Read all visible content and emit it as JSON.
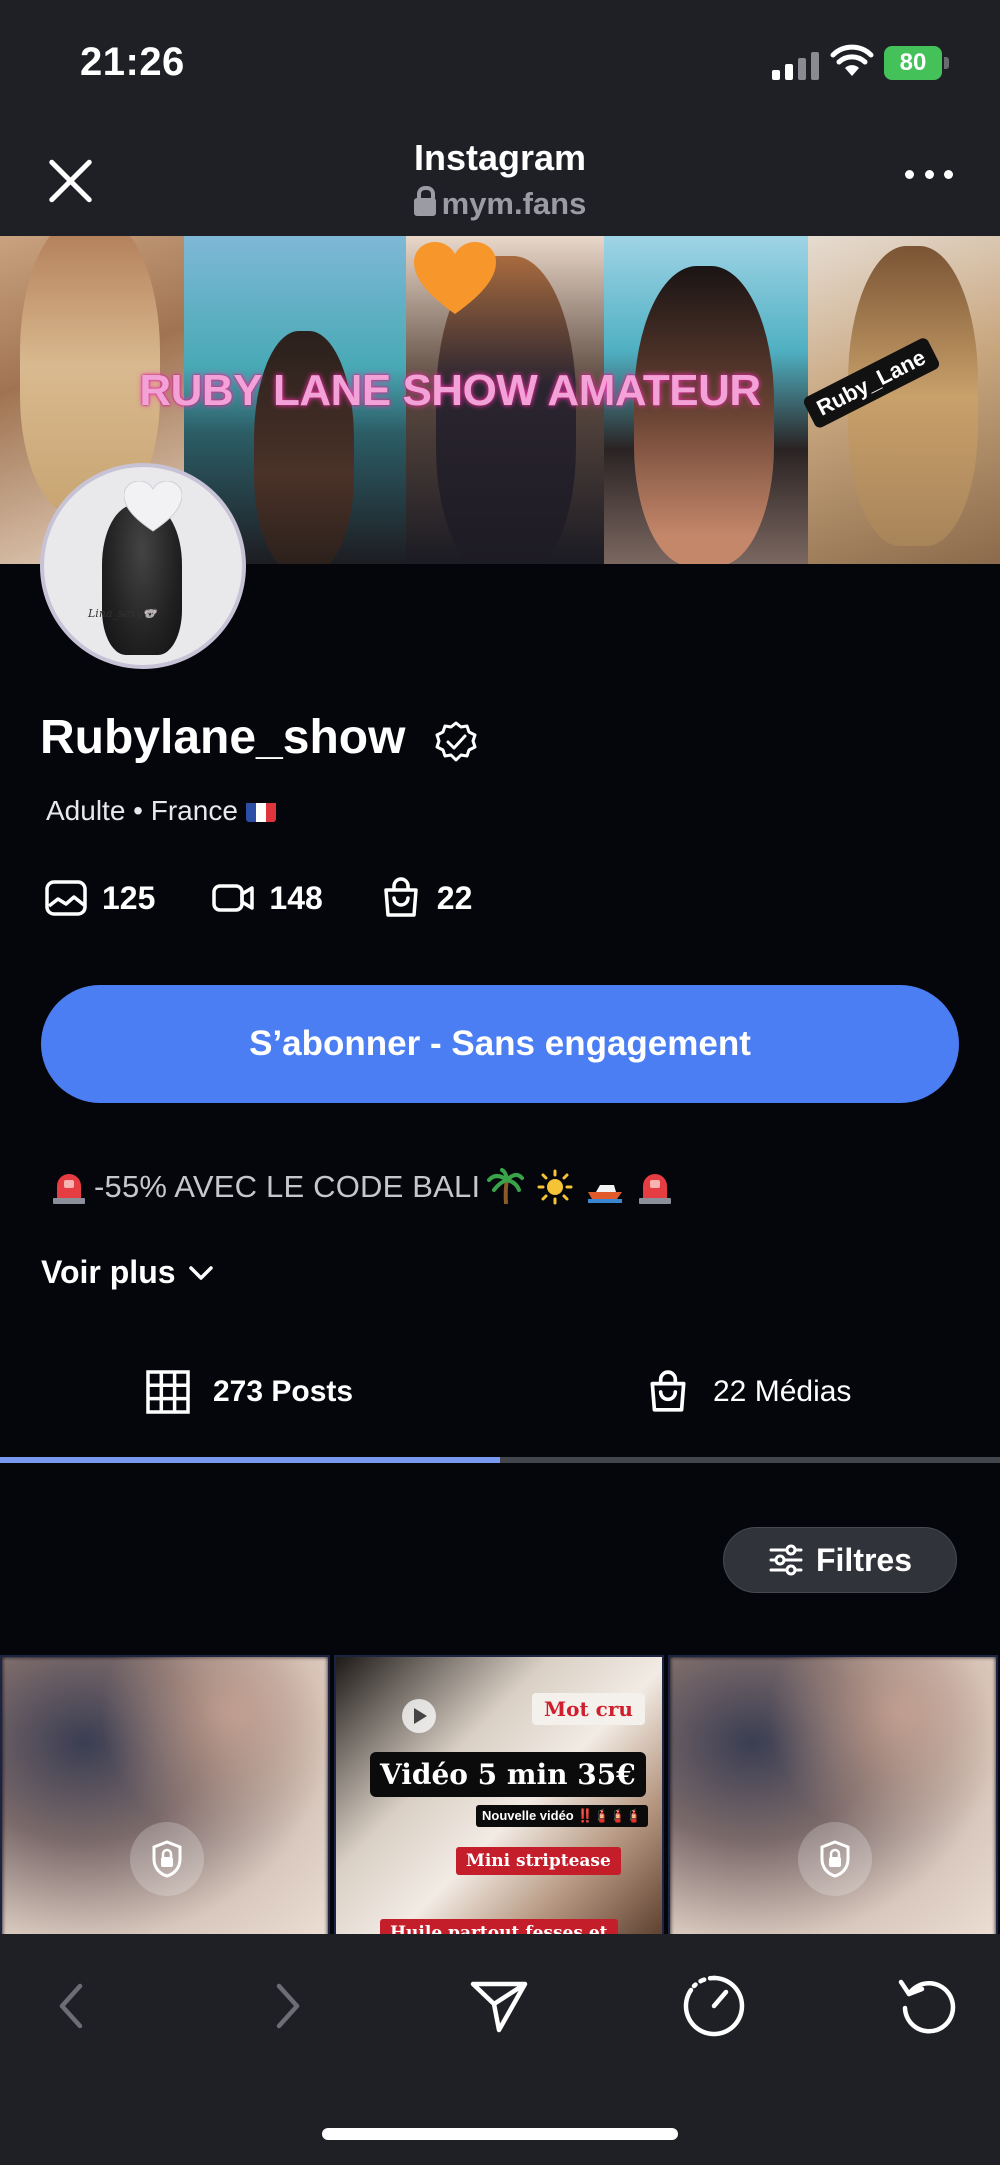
{
  "status_bar": {
    "time": "21:26",
    "battery": "80"
  },
  "browser_header": {
    "title": "Instagram",
    "url": "mym.fans"
  },
  "banner": {
    "overlay_text": "RUBY LANE SHOW AMATEUR",
    "tag_text": "Ruby_Lane"
  },
  "avatar": {
    "signature": "Lina_sexy🐨"
  },
  "profile": {
    "name": "Rubylane_show",
    "meta": "Adulte • France",
    "stats": [
      {
        "icon": "photo-icon",
        "value": "125"
      },
      {
        "icon": "video-icon",
        "value": "148"
      },
      {
        "icon": "bag-icon",
        "value": "22"
      }
    ]
  },
  "subscribe_label": "S’abonner - Sans engagement",
  "promo": "-55% AVEC LE CODE BALI",
  "voir_plus": "Voir plus",
  "tabs": [
    {
      "label": "273 Posts",
      "icon": "grid-icon",
      "active": true
    },
    {
      "label": "22 Médias",
      "icon": "bag-icon",
      "active": false
    }
  ],
  "filters_label": "Filtres",
  "video_post": {
    "tag": "Mot cru",
    "title": "Vidéo 5 min 35€",
    "subtitle": "Nouvelle vidéo ‼️🧯🧯🧯",
    "label_mini": "Mini striptease",
    "label_huile": "Huile partout fesses et"
  },
  "colors": {
    "accent": "#4c7ef3",
    "tab_indicator": "#7a99f0",
    "chrome": "#1f2026",
    "background": "#05060c",
    "banner_text": "#f3a2d8"
  }
}
